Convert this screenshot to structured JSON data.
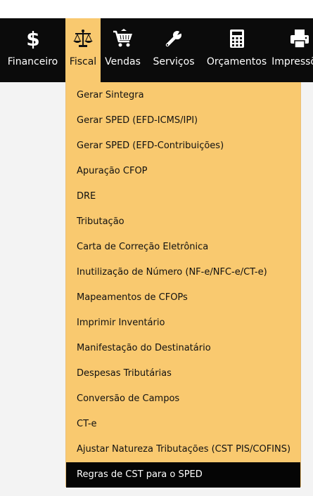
{
  "colors": {
    "navbar_bg": "#0b0b0b",
    "active_bg": "#f9c96f",
    "dropdown_bg": "#f9c96f",
    "selected_bg": "#050505",
    "page_bg": "#f3f3f3"
  },
  "nav": {
    "items": [
      {
        "label": "Financeiro",
        "icon": "dollar-icon",
        "active": false
      },
      {
        "label": "Fiscal",
        "icon": "scales-icon",
        "active": true
      },
      {
        "label": "Vendas",
        "icon": "shopping-cart-icon",
        "active": false
      },
      {
        "label": "Serviços",
        "icon": "wrench-icon",
        "active": false
      },
      {
        "label": "Orçamentos",
        "icon": "calculator-icon",
        "active": false
      },
      {
        "label": "Impressões",
        "icon": "printer-icon",
        "active": false
      }
    ]
  },
  "fiscal_menu": {
    "items": [
      "Gerar Sintegra",
      "Gerar SPED (EFD-ICMS/IPI)",
      "Gerar SPED (EFD-Contribuições)",
      "Apuração CFOP",
      "DRE",
      "Tributação",
      "Carta de Correção Eletrônica",
      "Inutilização de Número (NF-e/NFC-e/CT-e)",
      "Mapeamentos de CFOPs",
      "Imprimir Inventário",
      "Manifestação do Destinatário",
      "Despesas Tributárias",
      "Conversão de Campos",
      "CT-e",
      "Ajustar Natureza Tributações (CST PIS/COFINS)",
      "Regras de CST para o SPED"
    ],
    "selected_index": 15
  }
}
